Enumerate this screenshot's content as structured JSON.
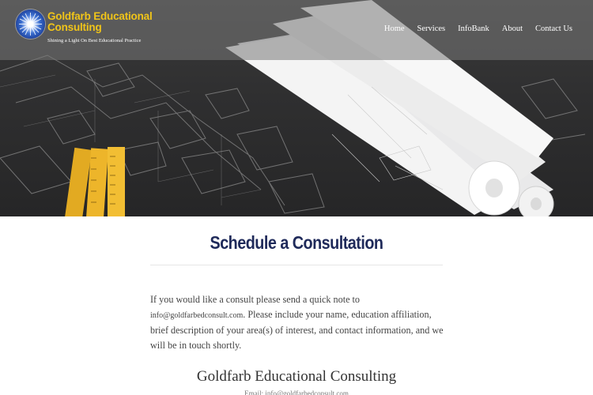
{
  "header": {
    "logo": {
      "title_line1": "Goldfarb Educational",
      "title_line2": "Consulting",
      "tagline": "Shining a Light On Best Educational Practice",
      "icon": "sunburst-logo-icon"
    },
    "nav": [
      "Home",
      "Services",
      "InfoBank",
      "About",
      "Contact Us"
    ]
  },
  "hero": {
    "description_icon": "blueprints-hero-image"
  },
  "main": {
    "title": "Schedule a Consultation",
    "body_before": "If you would like a consult please send a quick note to ",
    "email": "info@goldfarbedconsult.com",
    "body_after": ". Please include your name, education affiliation, brief description of your area(s) of interest, and contact information, and we will be in touch shortly."
  },
  "footer": {
    "title": "Goldfarb Educational Consulting",
    "subtitle": "Email: info@goldfarbedconsult.com"
  },
  "colors": {
    "brand_gold": "#f0c419",
    "title_navy": "#1f2a5a",
    "header_overlay": "#787878"
  }
}
